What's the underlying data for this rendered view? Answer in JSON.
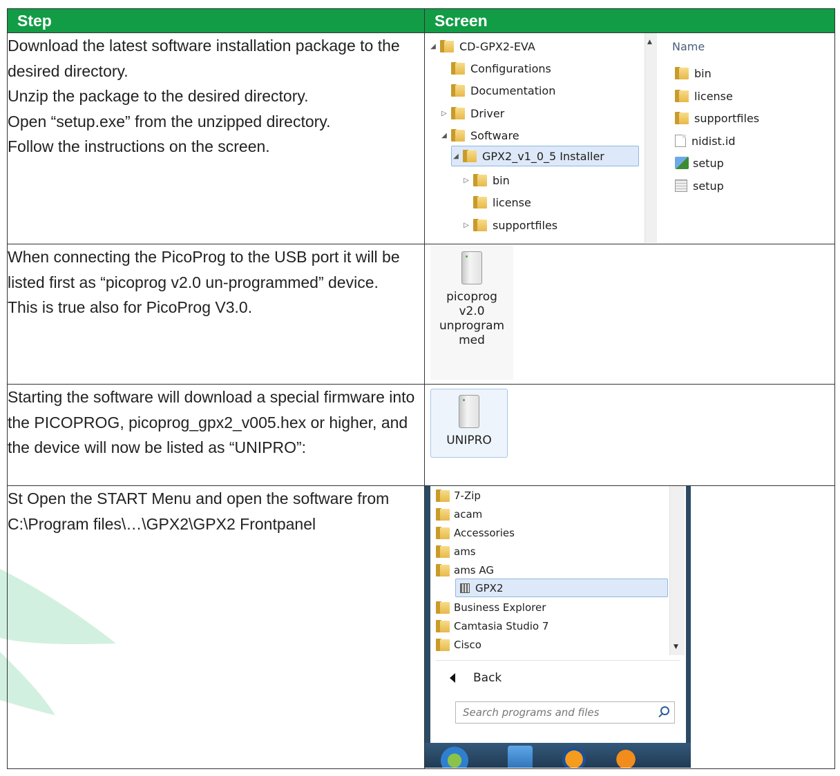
{
  "table": {
    "headers": {
      "step": "Step",
      "screen": "Screen"
    },
    "rows": [
      {
        "text": [
          "Download the latest software installation package to the desired directory.",
          "Unzip the package to the desired directory.",
          "Open “setup.exe” from the unzipped directory.",
          "Follow the instructions on the screen."
        ]
      },
      {
        "text": [
          "When connecting the PicoProg to the USB port it will be listed first as “picoprog v2.0 un-programmed” device.",
          "This is true also for PicoProg V3.0."
        ]
      },
      {
        "text": [
          "Starting the software will download a special firmware into the PICOPROG, picoprog_gpx2_v005.hex or higher, and the device will now be listed as “UNIPRO”:"
        ]
      },
      {
        "text": [
          "St Open the START Menu and open the software from",
          "C:\\Program files\\…\\GPX2\\GPX2 Frontpanel"
        ]
      }
    ]
  },
  "explorer": {
    "tree": [
      "CD-GPX2-EVA",
      "Configurations",
      "Documentation",
      "Driver",
      "Software",
      "GPX2_v1_0_5 Installer",
      "bin",
      "license",
      "supportfiles"
    ],
    "name_header": "Name",
    "files": [
      "bin",
      "license",
      "supportfiles",
      "nidist.id",
      "setup",
      "setup"
    ]
  },
  "device_unprogrammed": {
    "label_lines": [
      "picoprog",
      "v2.0",
      "unprogram",
      "med"
    ]
  },
  "device_unipro": {
    "label": "UNIPRO"
  },
  "start_menu": {
    "items": [
      "7-Zip",
      "acam",
      "Accessories",
      "ams",
      "ams AG",
      "GPX2",
      "Business Explorer",
      "Camtasia Studio 7",
      "Cisco"
    ],
    "back": "Back",
    "search_placeholder": "Search programs and files"
  },
  "colors": {
    "header_green": "#119c45",
    "swoosh_green": "#cdeedd"
  }
}
